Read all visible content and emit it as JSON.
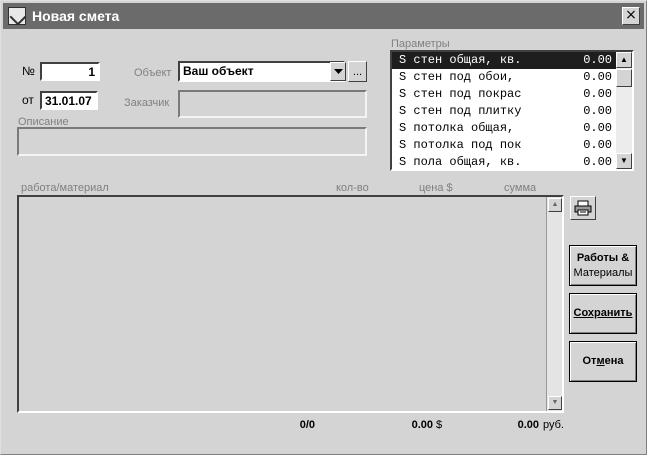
{
  "window": {
    "title": "Новая смета",
    "close_glyph": "×"
  },
  "form": {
    "number_label": "№",
    "number_value": "1",
    "date_label": "от",
    "date_value": "31.01.07",
    "object_label": "Объект",
    "object_value": "Ваш объект",
    "browse_label": "...",
    "customer_label": "Заказчик",
    "customer_value": "",
    "description_label": "Описание",
    "description_value": ""
  },
  "parameters": {
    "label": "Параметры",
    "items": [
      {
        "name": "S стен общая, кв.",
        "value": "0.00"
      },
      {
        "name": "S стен под обои,",
        "value": "0.00"
      },
      {
        "name": "S стен под покрас",
        "value": "0.00"
      },
      {
        "name": "S стен под плитку",
        "value": "0.00"
      },
      {
        "name": "S потолка общая,",
        "value": "0.00"
      },
      {
        "name": "S потолка под пок",
        "value": "0.00"
      },
      {
        "name": "S пола общая, кв.",
        "value": "0.00"
      }
    ],
    "selected_index": 0
  },
  "table": {
    "columns": [
      "работа/материал",
      "кол-во",
      "цена $",
      "сумма"
    ],
    "rows": []
  },
  "buttons": {
    "works_line1": "Работы &",
    "works_line2": "Материалы",
    "save": "Сохранить",
    "cancel_pre": "От",
    "cancel_ul": "м",
    "cancel_post": "ена",
    "print_icon": "printer-icon"
  },
  "totals": {
    "count": "0/0",
    "dollars": "0.00",
    "dollar_sign": "$",
    "rubles": "0.00",
    "rub_label": "руб."
  },
  "icons": [
    "app-icon",
    "close-icon",
    "chevron-down-icon",
    "scroll-up-icon",
    "scroll-down-icon",
    "printer-icon"
  ]
}
